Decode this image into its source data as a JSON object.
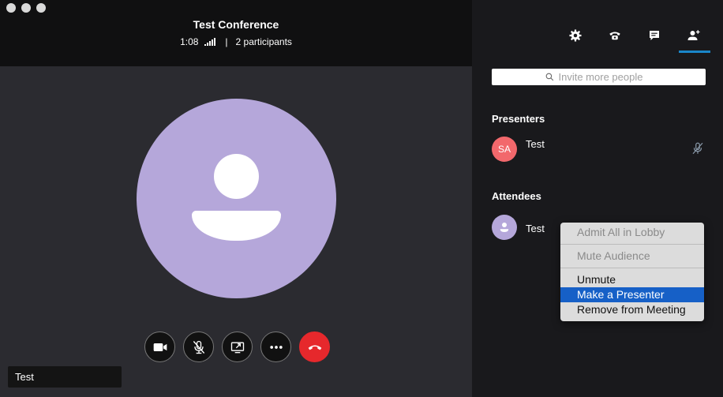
{
  "conference": {
    "title": "Test Conference",
    "duration": "1:08",
    "separator": "|",
    "participants": "2 participants"
  },
  "self_view": {
    "name": "Test",
    "avatar_color": "#b5a7da"
  },
  "controls": [
    {
      "name": "video-button",
      "icon": "video-icon"
    },
    {
      "name": "mute-button",
      "icon": "mic-off-icon"
    },
    {
      "name": "share-screen-button",
      "icon": "share-screen-icon"
    },
    {
      "name": "more-button",
      "icon": "more-icon"
    },
    {
      "name": "hang-up-button",
      "icon": "hang-up-icon",
      "color": "#e6282c"
    }
  ],
  "panel": {
    "tabs": [
      "settings-icon",
      "phone-icon",
      "chat-icon",
      "add-person-icon"
    ],
    "active_tab": "add-person-icon",
    "accent": "#1a86c9",
    "search_placeholder": "Invite more people",
    "presenters_title": "Presenters",
    "presenters": [
      {
        "initials": "SA",
        "name": "Test",
        "color": "#f2686c"
      }
    ],
    "attendees_title": "Attendees",
    "attendees": [
      {
        "name": "Test",
        "color": "#b5a7da"
      }
    ]
  },
  "context_menu": {
    "items": [
      {
        "label": "Admit All in Lobby",
        "disabled": true
      },
      {
        "label": "Mute Audience",
        "disabled": true
      },
      {
        "label": "Unmute",
        "disabled": false
      },
      {
        "label": "Make a Presenter",
        "disabled": false,
        "selected": true
      },
      {
        "label": "Remove from Meeting",
        "disabled": false
      }
    ],
    "highlight": "#1660c7"
  }
}
